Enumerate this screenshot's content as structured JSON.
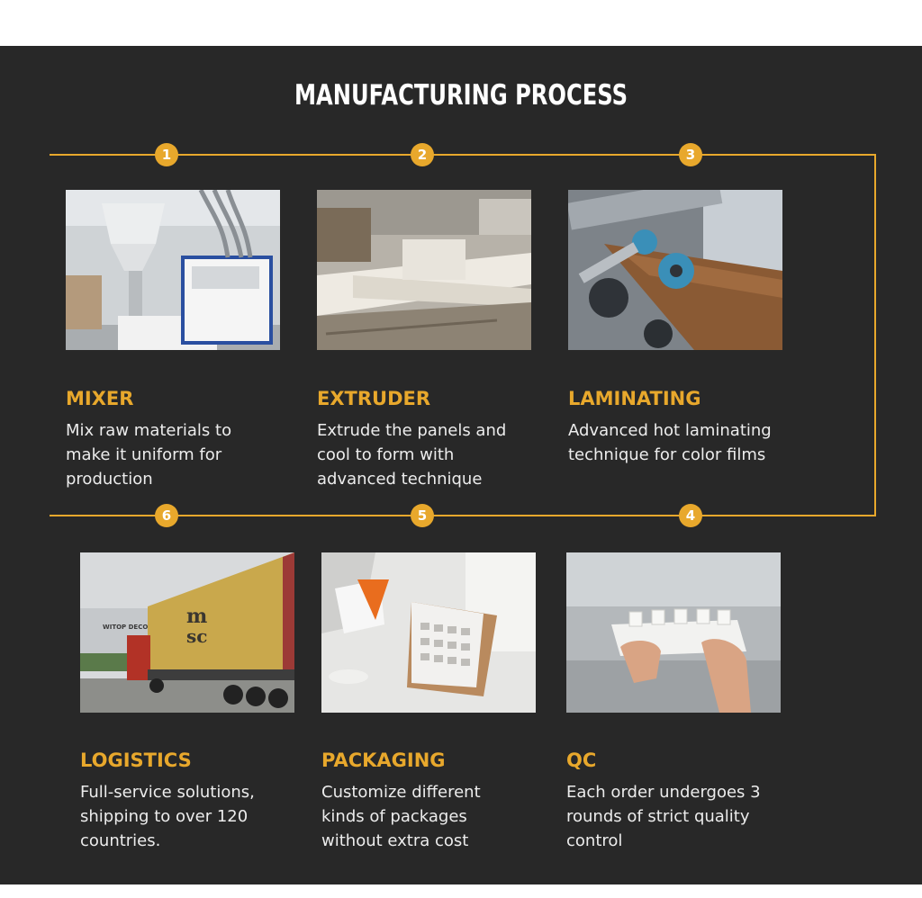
{
  "title": "MANUFACTURING PROCESS",
  "accent_color": "#e8a82c",
  "background_color": "#282828",
  "steps": [
    {
      "number": "1",
      "title": "MIXER",
      "description": "Mix raw materials to\nmake it uniform for\nproduction",
      "image": "mixer-machine-photo"
    },
    {
      "number": "2",
      "title": "EXTRUDER",
      "description": "Extrude the panels and\ncool to form with\nadvanced technique",
      "image": "extruder-machine-photo"
    },
    {
      "number": "3",
      "title": "LAMINATING",
      "description": "Advanced hot laminating\ntechnique for color films",
      "image": "laminating-rollers-photo"
    },
    {
      "number": "4",
      "title": "QC",
      "description": "Each order undergoes 3\nrounds of strict quality\ncontrol",
      "image": "qc-panel-inspection-photo"
    },
    {
      "number": "5",
      "title": "PACKAGING",
      "description": "Customize different\nkinds of packages\nwithout extra cost",
      "image": "packaging-boxes-photo"
    },
    {
      "number": "6",
      "title": "LOGISTICS",
      "description": "Full-service solutions,\nshipping to over 120\ncountries.",
      "image": "container-truck-photo"
    }
  ],
  "photo_text": {
    "building_sign": "WITOP DECO",
    "container_logo_top": "m",
    "container_logo_bottom": "sc"
  }
}
